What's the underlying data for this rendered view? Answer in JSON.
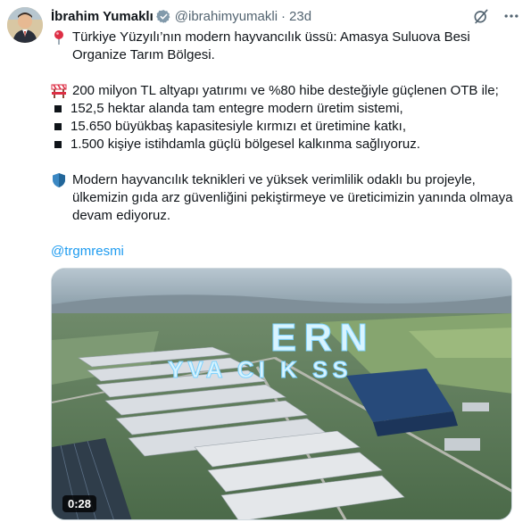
{
  "author": {
    "name": "İbrahim Yumaklı",
    "handle": "@ibrahimyumakli",
    "separator": "·",
    "time": "23d"
  },
  "icons": {
    "verified": "verified-badge-icon",
    "grok": "grok-icon",
    "more": "more-options-icon",
    "pin": "round-pushpin-emoji",
    "tractor": "construction-emoji",
    "shield": "shield-emoji"
  },
  "tweet": {
    "line1": "Türkiye Yüzyılı’nın modern hayvancılık üssü: Amasya Suluova Besi Organize Tarım Bölgesi.",
    "line2": "200 milyon TL altyapı yatırımı ve %80 hibe desteğiyle güçlenen OTB ile;",
    "bullets": [
      "152,5 hektar alanda tam entegre modern üretim sistemi,",
      "15.650 büyükbaş kapasitesiyle kırmızı et üretimine katkı,",
      "1.500 kişiye istihdamla güçlü bölgesel kalkınma sağlıyoruz."
    ],
    "line3": "Modern hayvancılık teknikleri ve yüksek verimlilik odaklı bu projeyle, ülkemizin gıda arz güvenliğini pekiştirmeye ve üreticimizin yanında olmaya devam ediyoruz.",
    "mention": "@trgmresmi"
  },
  "media": {
    "duration": "0:28",
    "overlay_top": "ERN",
    "overlay_bottom": "YVA CI K SS"
  },
  "colors": {
    "accent": "#1d9bf0",
    "muted": "#536471",
    "text": "#0f1419"
  }
}
